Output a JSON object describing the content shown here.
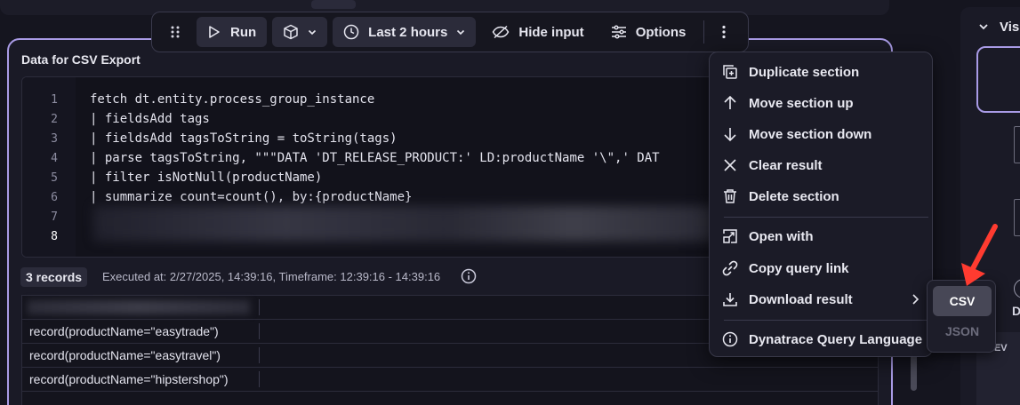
{
  "toolbar": {
    "run_label": "Run",
    "timeframe_label": "Last 2 hours",
    "hide_input_label": "Hide input",
    "options_label": "Options"
  },
  "section": {
    "title": "Data for CSV Export",
    "code_lines": [
      "fetch dt.entity.process_group_instance",
      "| fieldsAdd tags",
      "| fieldsAdd tagsToString = toString(tags)",
      "| parse tagsToString, \"\"\"DATA 'DT_RELEASE_PRODUCT:' LD:productName '\\\",' DAT",
      "| filter isNotNull(productName)",
      "| summarize count=count(), by:{productName}",
      "",
      ""
    ],
    "line_numbers": [
      "1",
      "2",
      "3",
      "4",
      "5",
      "6",
      "7",
      "8"
    ],
    "records_badge": "3 records",
    "executed_text": "Executed at: 2/27/2025, 14:39:16, Timeframe: 12:39:16 - 14:39:16",
    "rows": [
      "record(productName=\"easytrade\")",
      "record(productName=\"easytravel\")",
      "record(productName=\"hipstershop\")"
    ]
  },
  "menu": {
    "items": [
      {
        "label": "Duplicate section",
        "icon": "duplicate-icon"
      },
      {
        "label": "Move section up",
        "icon": "arrow-up-icon"
      },
      {
        "label": "Move section down",
        "icon": "arrow-down-icon"
      },
      {
        "label": "Clear result",
        "icon": "close-icon"
      },
      {
        "label": "Delete section",
        "icon": "trash-icon"
      },
      {
        "label": "Open with",
        "icon": "open-with-icon"
      },
      {
        "label": "Copy query link",
        "icon": "link-icon"
      },
      {
        "label": "Download result",
        "icon": "download-icon"
      },
      {
        "label": "Dynatrace Query Language",
        "icon": "info-icon"
      }
    ]
  },
  "submenu": {
    "csv_label": "CSV",
    "json_label": "JSON"
  },
  "right_panel": {
    "title": "Vis",
    "d_label": "D",
    "new_label": "NEV"
  },
  "colors": {
    "accent": "#a99be6",
    "background": "#15151f",
    "pointer_arrow": "#ff3b30"
  }
}
